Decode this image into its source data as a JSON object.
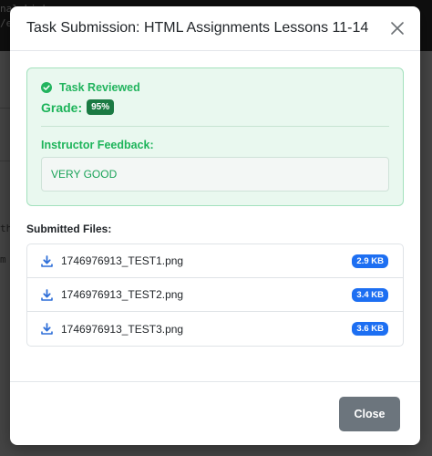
{
  "background": {
    "code_lines": [
      "nal Link -->",
      "/e"
    ],
    "fragments": [
      "th",
      "m"
    ]
  },
  "modal": {
    "title": "Task Submission: HTML Assignments Lessons 11-14",
    "close_icon": "close-icon"
  },
  "review": {
    "status_icon": "check-circle-icon",
    "status": "Task Reviewed",
    "grade_label": "Grade:",
    "grade_value": "95%",
    "feedback_label": "Instructor Feedback:",
    "feedback_text": "VERY GOOD"
  },
  "files": {
    "label": "Submitted Files:",
    "icon": "download-icon",
    "items": [
      {
        "name": "1746976913_TEST1.png",
        "size": "2.9 KB"
      },
      {
        "name": "1746976913_TEST2.png",
        "size": "3.4 KB"
      },
      {
        "name": "1746976913_TEST3.png",
        "size": "3.6 KB"
      }
    ]
  },
  "footer": {
    "close_label": "Close"
  },
  "colors": {
    "success": "#22b45e",
    "badge_primary": "#1d6ff2",
    "grade_badge": "#1b7a43",
    "secondary_button": "#6c757d"
  }
}
